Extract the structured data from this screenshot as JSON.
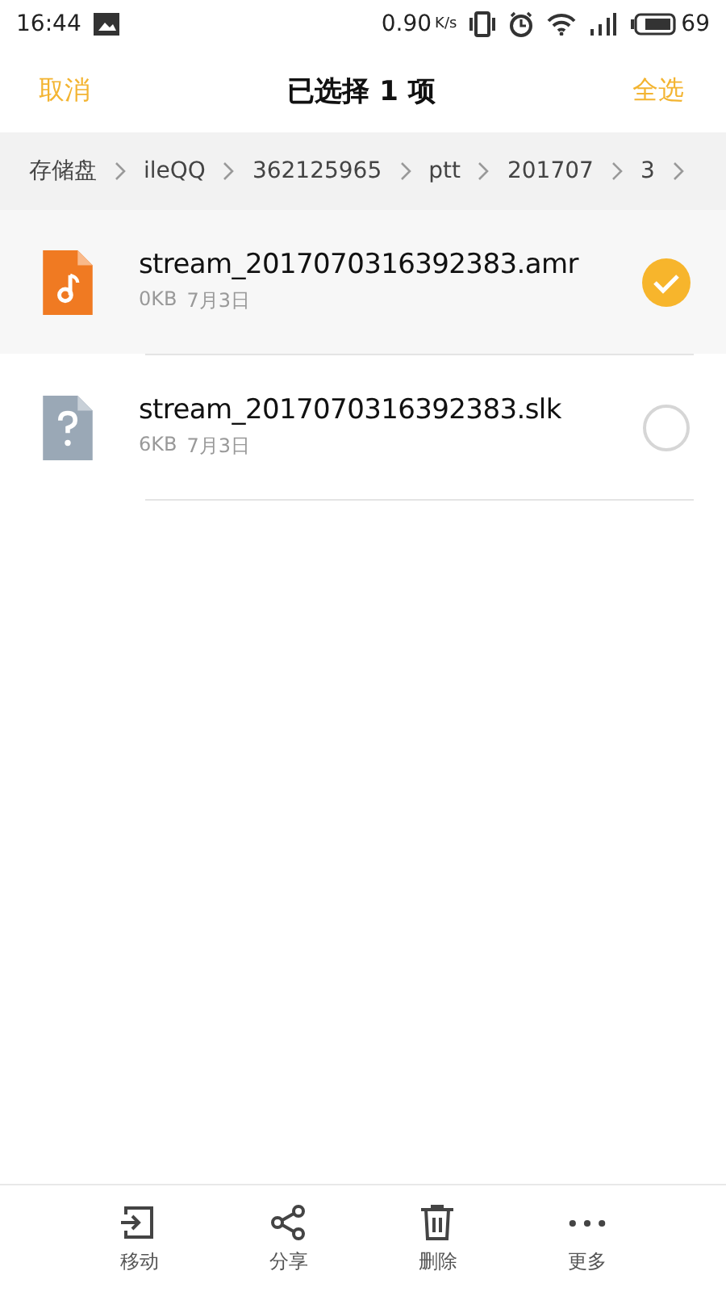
{
  "status_bar": {
    "time": "16:44",
    "speed": "0.90",
    "speed_unit": "K/s",
    "battery": "69"
  },
  "header": {
    "cancel": "取消",
    "title": "已选择 1 项",
    "select_all": "全选"
  },
  "breadcrumb": [
    "存储盘",
    "ileQQ",
    "362125965",
    "ptt",
    "201707",
    "3"
  ],
  "files": [
    {
      "name": "stream_2017070316392383.amr",
      "size": "0KB",
      "date": "7月3日",
      "kind": "audio",
      "selected": true
    },
    {
      "name": "stream_2017070316392383.slk",
      "size": "6KB",
      "date": "7月3日",
      "kind": "unknown",
      "selected": false
    }
  ],
  "actions": [
    {
      "kind": "move",
      "label": "移动"
    },
    {
      "kind": "share",
      "label": "分享"
    },
    {
      "kind": "delete",
      "label": "删除"
    },
    {
      "kind": "more",
      "label": "更多"
    }
  ]
}
